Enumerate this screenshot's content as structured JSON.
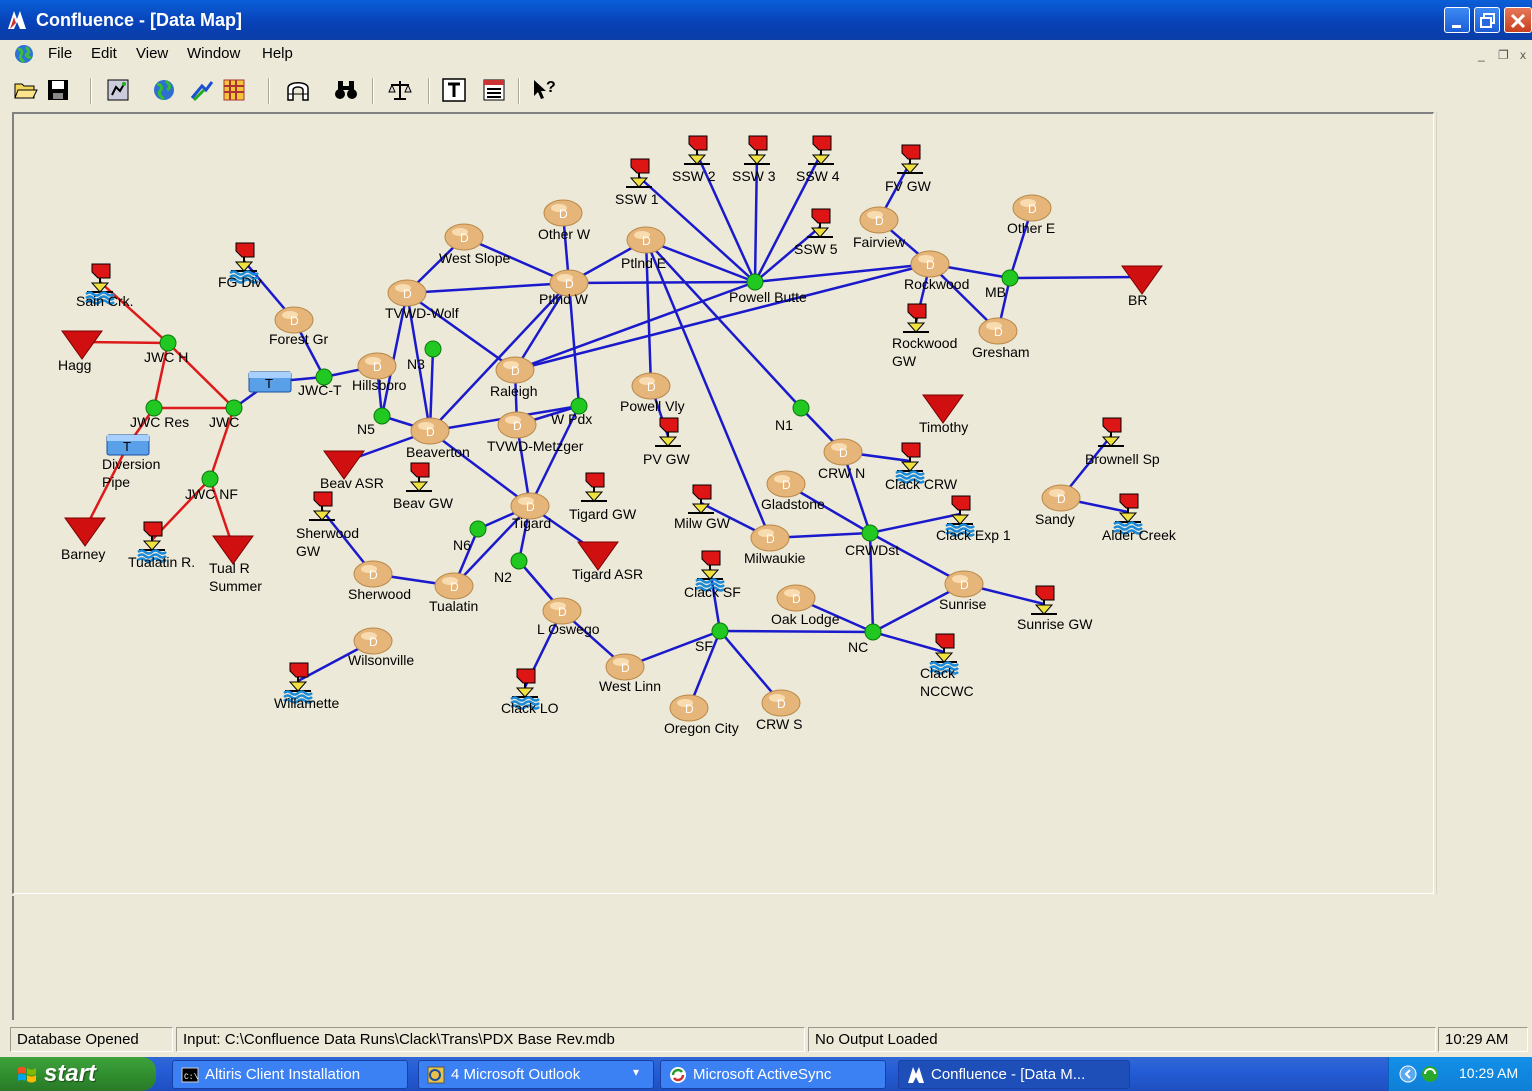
{
  "window": {
    "title": "Confluence - [Data Map]"
  },
  "menu": [
    "File",
    "Edit",
    "View",
    "Window",
    "Help"
  ],
  "toolbar": [
    "open-icon",
    "save-icon",
    "map-icon",
    "globe-icon",
    "arrows-icon",
    "grid-icon",
    "arch-icon",
    "binoculars-icon",
    "scale-icon",
    "text-icon",
    "list-icon",
    "help-pointer-icon"
  ],
  "node_types": {
    "D": "D",
    "T": "T"
  },
  "colors": {
    "demand": "#e6b57a",
    "junction": "#22c822",
    "sink": "#d01010",
    "link_blue": "#1a1acc",
    "link_red": "#dd1a1a",
    "transfer": "#5aa0e8"
  },
  "map": {
    "demand_nodes": [
      {
        "id": "other_w",
        "label": "Other W"
      },
      {
        "id": "west_slope",
        "label": "West Slope"
      },
      {
        "id": "ptlnd_e",
        "label": "Ptlnd E"
      },
      {
        "id": "fairview",
        "label": "Fairview"
      },
      {
        "id": "other_e",
        "label": "Other E"
      },
      {
        "id": "tvwd_wolf",
        "label": "TVWD-Wolf"
      },
      {
        "id": "ptlnd_w",
        "label": "Ptlnd W"
      },
      {
        "id": "rockwood",
        "label": "Rockwood"
      },
      {
        "id": "forest_gr",
        "label": "Forest Gr"
      },
      {
        "id": "gresham",
        "label": "Gresham"
      },
      {
        "id": "hillsboro",
        "label": "Hillsboro"
      },
      {
        "id": "raleigh",
        "label": "Raleigh"
      },
      {
        "id": "powell_vly",
        "label": "Powell Vly"
      },
      {
        "id": "beaverton",
        "label": "Beaverton"
      },
      {
        "id": "tvwd_metzger",
        "label": "TVWD-Metzger"
      },
      {
        "id": "crw_n",
        "label": "CRW N"
      },
      {
        "id": "gladstone",
        "label": "Gladstone"
      },
      {
        "id": "tigard",
        "label": "Tigard"
      },
      {
        "id": "sandy",
        "label": "Sandy"
      },
      {
        "id": "milwaukie",
        "label": "Milwaukie"
      },
      {
        "id": "sherwood",
        "label": "Sherwood"
      },
      {
        "id": "tualatin",
        "label": "Tualatin"
      },
      {
        "id": "sunrise",
        "label": "Sunrise"
      },
      {
        "id": "oak_lodge",
        "label": "Oak Lodge"
      },
      {
        "id": "l_oswego",
        "label": "L Oswego"
      },
      {
        "id": "wilsonville",
        "label": "Wilsonville"
      },
      {
        "id": "west_linn",
        "label": "West Linn"
      },
      {
        "id": "oregon_city",
        "label": "Oregon City"
      },
      {
        "id": "crw_s",
        "label": "CRW S"
      }
    ],
    "junctions": [
      {
        "id": "jwc_h",
        "label": "JWC H"
      },
      {
        "id": "jwc_res",
        "label": "JWC Res"
      },
      {
        "id": "jwc",
        "label": "JWC"
      },
      {
        "id": "jwc_nf",
        "label": "JWC NF"
      },
      {
        "id": "jwc_t",
        "label": "JWC-T"
      },
      {
        "id": "n3",
        "label": "N3"
      },
      {
        "id": "n5",
        "label": "N5"
      },
      {
        "id": "w_pdx",
        "label": "W Pdx"
      },
      {
        "id": "powell_butte",
        "label": "Powell Butte"
      },
      {
        "id": "mb",
        "label": "MB"
      },
      {
        "id": "n1",
        "label": "N1"
      },
      {
        "id": "crwdst",
        "label": "CRWDst"
      },
      {
        "id": "n6",
        "label": "N6"
      },
      {
        "id": "n2",
        "label": "N2"
      },
      {
        "id": "sf",
        "label": "SF"
      },
      {
        "id": "nc",
        "label": "NC"
      }
    ],
    "sinks": [
      {
        "id": "hagg",
        "label": "Hagg"
      },
      {
        "id": "barney",
        "label": "Barney"
      },
      {
        "id": "tual_r_summer",
        "label": "Tual R\nSummer"
      },
      {
        "id": "beav_asr",
        "label": "Beav ASR"
      },
      {
        "id": "tigard_asr",
        "label": "Tigard ASR"
      },
      {
        "id": "timothy",
        "label": "Timothy"
      },
      {
        "id": "br",
        "label": "BR"
      }
    ],
    "supplies": [
      {
        "id": "sain_crk",
        "label": "Sain Crk.",
        "water": true
      },
      {
        "id": "fg_div",
        "label": "FG Div",
        "water": true
      },
      {
        "id": "ssw1",
        "label": "SSW 1",
        "water": false
      },
      {
        "id": "ssw2",
        "label": "SSW 2",
        "water": false
      },
      {
        "id": "ssw3",
        "label": "SSW 3",
        "water": false
      },
      {
        "id": "ssw4",
        "label": "SSW 4",
        "water": false
      },
      {
        "id": "ssw5",
        "label": "SSW 5",
        "water": false
      },
      {
        "id": "fv_gw",
        "label": "FV GW",
        "water": false
      },
      {
        "id": "rockwood_gw",
        "label": "Rockwood\nGW",
        "water": false
      },
      {
        "id": "pv_gw",
        "label": "PV GW",
        "water": false
      },
      {
        "id": "beav_gw",
        "label": "Beav GW",
        "water": false
      },
      {
        "id": "tigard_gw",
        "label": "Tigard GW",
        "water": false
      },
      {
        "id": "sherwood_gw",
        "label": "Sherwood\nGW",
        "water": false
      },
      {
        "id": "tualatin_r",
        "label": "Tualatin R.",
        "water": true
      },
      {
        "id": "milw_gw",
        "label": "Milw GW",
        "water": false
      },
      {
        "id": "clack_crw",
        "label": "Clack CRW",
        "water": true
      },
      {
        "id": "clack_exp1",
        "label": "Clack Exp 1",
        "water": true
      },
      {
        "id": "brownell_sp",
        "label": "Brownell Sp",
        "water": false
      },
      {
        "id": "alder_creek",
        "label": "Alder Creek",
        "water": true
      },
      {
        "id": "clack_sf",
        "label": "Clack SF",
        "water": true
      },
      {
        "id": "sunrise_gw",
        "label": "Sunrise GW",
        "water": false
      },
      {
        "id": "clack_nccwc",
        "label": "Clack\nNCCWC",
        "water": true
      },
      {
        "id": "willamette",
        "label": "Willamette",
        "water": true
      },
      {
        "id": "clack_lo",
        "label": "Clack LO",
        "water": true
      }
    ],
    "transfers": [
      {
        "id": "diversion_pipe",
        "label": "Diversion\nPipe"
      },
      {
        "id": "jwc_tank",
        "label": ""
      }
    ],
    "links": [
      [
        "sain_crk",
        "jwc_h",
        "red"
      ],
      [
        "hagg",
        "jwc_h",
        "red"
      ],
      [
        "jwc_h",
        "jwc_res",
        "red"
      ],
      [
        "jwc_h",
        "jwc",
        "red"
      ],
      [
        "jwc_res",
        "jwc",
        "red"
      ],
      [
        "jwc_res",
        "diversion_pipe",
        "red"
      ],
      [
        "diversion_pipe",
        "barney",
        "red"
      ],
      [
        "jwc",
        "jwc_nf",
        "red"
      ],
      [
        "jwc_nf",
        "tualatin_r",
        "red"
      ],
      [
        "jwc_nf",
        "tual_r_summer",
        "red"
      ],
      [
        "jwc",
        "jwc_tank",
        "blue"
      ],
      [
        "jwc_tank",
        "jwc_t",
        "blue"
      ],
      [
        "fg_div",
        "forest_gr",
        "blue"
      ],
      [
        "forest_gr",
        "jwc_t",
        "blue"
      ],
      [
        "jwc_t",
        "hillsboro",
        "blue"
      ],
      [
        "hillsboro",
        "n5",
        "blue"
      ],
      [
        "n5",
        "beaverton",
        "blue"
      ],
      [
        "n5",
        "tvwd_wolf",
        "blue"
      ],
      [
        "tvwd_wolf",
        "west_slope",
        "blue"
      ],
      [
        "tvwd_wolf",
        "ptlnd_w",
        "blue"
      ],
      [
        "west_slope",
        "ptlnd_w",
        "blue"
      ],
      [
        "other_w",
        "ptlnd_w",
        "blue"
      ],
      [
        "ptlnd_w",
        "ptlnd_e",
        "blue"
      ],
      [
        "ptlnd_w",
        "powell_butte",
        "blue"
      ],
      [
        "ptlnd_w",
        "raleigh",
        "blue"
      ],
      [
        "ptlnd_w",
        "w_pdx",
        "blue"
      ],
      [
        "ptlnd_w",
        "beaverton",
        "blue"
      ],
      [
        "tvwd_wolf",
        "raleigh",
        "blue"
      ],
      [
        "n3",
        "beaverton",
        "blue"
      ],
      [
        "beaverton",
        "w_pdx",
        "blue"
      ],
      [
        "beaverton",
        "beav_asr",
        "blue"
      ],
      [
        "beaverton",
        "tigard",
        "blue"
      ],
      [
        "raleigh",
        "rockwood",
        "blue"
      ],
      [
        "raleigh",
        "tvwd_metzger",
        "blue"
      ],
      [
        "w_pdx",
        "tvwd_metzger",
        "blue"
      ],
      [
        "w_pdx",
        "tigard",
        "blue"
      ],
      [
        "tvwd_metzger",
        "tigard",
        "blue"
      ],
      [
        "tigard",
        "tigard_asr",
        "blue"
      ],
      [
        "tigard",
        "n6",
        "blue"
      ],
      [
        "tigard",
        "n2",
        "blue"
      ],
      [
        "tigard",
        "tualatin",
        "blue"
      ],
      [
        "n6",
        "tualatin",
        "blue"
      ],
      [
        "sherwood_gw",
        "sherwood",
        "blue"
      ],
      [
        "sherwood",
        "tualatin",
        "blue"
      ],
      [
        "n2",
        "l_oswego",
        "blue"
      ],
      [
        "l_oswego",
        "west_linn",
        "blue"
      ],
      [
        "l_oswego",
        "clack_lo",
        "blue"
      ],
      [
        "west_linn",
        "sf",
        "blue"
      ],
      [
        "sf",
        "clack_sf",
        "blue"
      ],
      [
        "sf",
        "oregon_city",
        "blue"
      ],
      [
        "sf",
        "crw_s",
        "blue"
      ],
      [
        "sf",
        "nc",
        "blue"
      ],
      [
        "oak_lodge",
        "nc",
        "blue"
      ],
      [
        "nc",
        "sunrise",
        "blue"
      ],
      [
        "nc",
        "clack_nccwc",
        "blue"
      ],
      [
        "nc",
        "crwdst",
        "blue"
      ],
      [
        "sunrise",
        "sunrise_gw",
        "blue"
      ],
      [
        "crwdst",
        "sunrise",
        "blue"
      ],
      [
        "crwdst",
        "clack_exp1",
        "blue"
      ],
      [
        "crwdst",
        "gladstone",
        "blue"
      ],
      [
        "crwdst",
        "milwaukie",
        "blue"
      ],
      [
        "crwdst",
        "crw_n",
        "blue"
      ],
      [
        "crw_n",
        "n1",
        "blue"
      ],
      [
        "n1",
        "ptlnd_e",
        "blue"
      ],
      [
        "milwaukie",
        "ptlnd_e",
        "blue"
      ],
      [
        "milwaukie",
        "milw_gw",
        "blue"
      ],
      [
        "ptlnd_e",
        "powell_vly",
        "blue"
      ],
      [
        "powell_vly",
        "pv_gw",
        "blue"
      ],
      [
        "ptlnd_e",
        "powell_butte",
        "blue"
      ],
      [
        "ssw1",
        "powell_butte",
        "blue"
      ],
      [
        "ssw2",
        "powell_butte",
        "blue"
      ],
      [
        "ssw3",
        "powell_butte",
        "blue"
      ],
      [
        "ssw4",
        "powell_butte",
        "blue"
      ],
      [
        "ssw5",
        "powell_butte",
        "blue"
      ],
      [
        "powell_butte",
        "rockwood",
        "blue"
      ],
      [
        "fairview",
        "rockwood",
        "blue"
      ],
      [
        "fv_gw",
        "fairview",
        "blue"
      ],
      [
        "rockwood",
        "mb",
        "blue"
      ],
      [
        "rockwood",
        "rockwood_gw",
        "blue"
      ],
      [
        "rockwood",
        "gresham",
        "blue"
      ],
      [
        "mb",
        "gresham",
        "blue"
      ],
      [
        "mb",
        "other_e",
        "blue"
      ],
      [
        "mb",
        "br",
        "blue"
      ],
      [
        "sandy",
        "brownell_sp",
        "blue"
      ],
      [
        "sandy",
        "alder_creek",
        "blue"
      ],
      [
        "crw_n",
        "clack_crw",
        "blue"
      ],
      [
        "wilsonville",
        "willamette",
        "blue"
      ],
      [
        "tvwd_wolf",
        "beaverton",
        "blue"
      ],
      [
        "powell_butte",
        "raleigh",
        "blue"
      ]
    ]
  },
  "status": {
    "state": "Database Opened",
    "input": "Input: C:\\Confluence Data Runs\\Clack\\Trans\\PDX Base Rev.mdb",
    "output": "No Output Loaded",
    "time": "10:29 AM"
  },
  "taskbar": {
    "start": "start",
    "tasks": [
      {
        "label": "Altiris Client Installation",
        "icon": "console-icon"
      },
      {
        "label": "4 Microsoft Outlook",
        "icon": "outlook-icon"
      },
      {
        "label": "Microsoft ActiveSync",
        "icon": "activesync-icon"
      },
      {
        "label": "Confluence - [Data M...",
        "icon": "confluence-icon"
      }
    ],
    "clock": "10:29 AM"
  }
}
